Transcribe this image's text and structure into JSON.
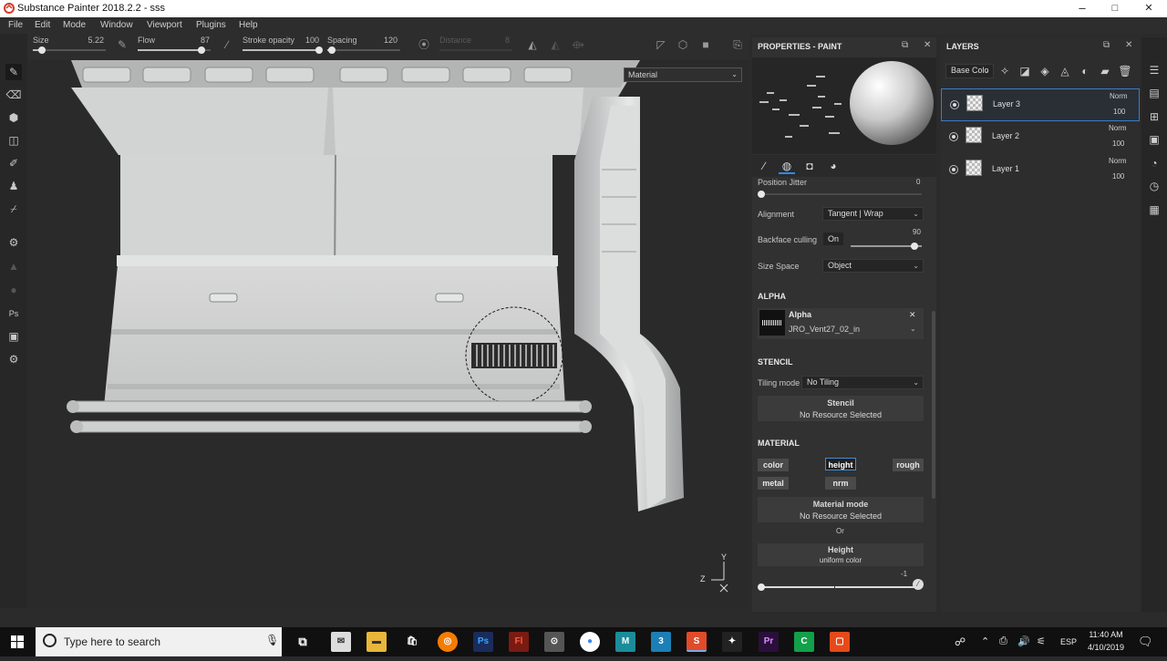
{
  "window": {
    "title": "Substance Painter 2018.2.2 - sss",
    "minimize": "–",
    "maximize": "□",
    "close": "✕"
  },
  "menu": [
    "File",
    "Edit",
    "Mode",
    "Window",
    "Viewport",
    "Plugins",
    "Help"
  ],
  "toolbar": {
    "size_label": "Size",
    "size_value": "5.22",
    "size_level": 0.12,
    "flow_label": "Flow",
    "flow_value": "87",
    "flow_level": 0.87,
    "opacity_label": "Stroke opacity",
    "opacity_value": "100",
    "opacity_level": 1.0,
    "spacing_label": "Spacing",
    "spacing_value": "120",
    "spacing_level": 0.06,
    "distance_label": "Distance",
    "distance_value": "8"
  },
  "viewport": {
    "material_dropdown": "Material",
    "axis_y": "Y",
    "axis_z": "Z"
  },
  "properties": {
    "title": "PROPERTIES - PAINT",
    "position_jitter_label": "Position Jitter",
    "position_jitter_value": "0",
    "alignment_label": "Alignment",
    "alignment_value": "Tangent | Wrap",
    "backface_label": "Backface culling",
    "backface_toggle": "On",
    "backface_value": "90",
    "backface_level": 0.9,
    "size_space_label": "Size Space",
    "size_space_value": "Object",
    "alpha_section": "ALPHA",
    "alpha_title": "Alpha",
    "alpha_resource": "JRO_Vent27_02_in",
    "stencil_section": "STENCIL",
    "tiling_label": "Tiling mode",
    "tiling_value": "No Tiling",
    "stencil_title": "Stencil",
    "stencil_resource": "No Resource Selected",
    "material_section": "MATERIAL",
    "channels": [
      "color",
      "height",
      "rough",
      "metal",
      "nrm"
    ],
    "active_channel": "height",
    "material_mode_title": "Material mode",
    "material_mode_resource": "No Resource Selected",
    "or_text": "Or",
    "height_title": "Height",
    "height_sub": "uniform color",
    "height_value": "-1"
  },
  "layers": {
    "title": "LAYERS",
    "channel_select": "Base Colo",
    "items": [
      {
        "name": "Layer 3",
        "blend": "Norm",
        "opacity": "100",
        "selected": true
      },
      {
        "name": "Layer 2",
        "blend": "Norm",
        "opacity": "100",
        "selected": false
      },
      {
        "name": "Layer 1",
        "blend": "Norm",
        "opacity": "100",
        "selected": false
      }
    ]
  },
  "taskbar": {
    "search_placeholder": "Type here to search",
    "language": "ESP",
    "time": "11:40 AM",
    "date": "4/10/2019"
  },
  "colors": {
    "accent": "#2d8ceb",
    "panel": "#313131",
    "viewport": "#2a2a2a"
  }
}
